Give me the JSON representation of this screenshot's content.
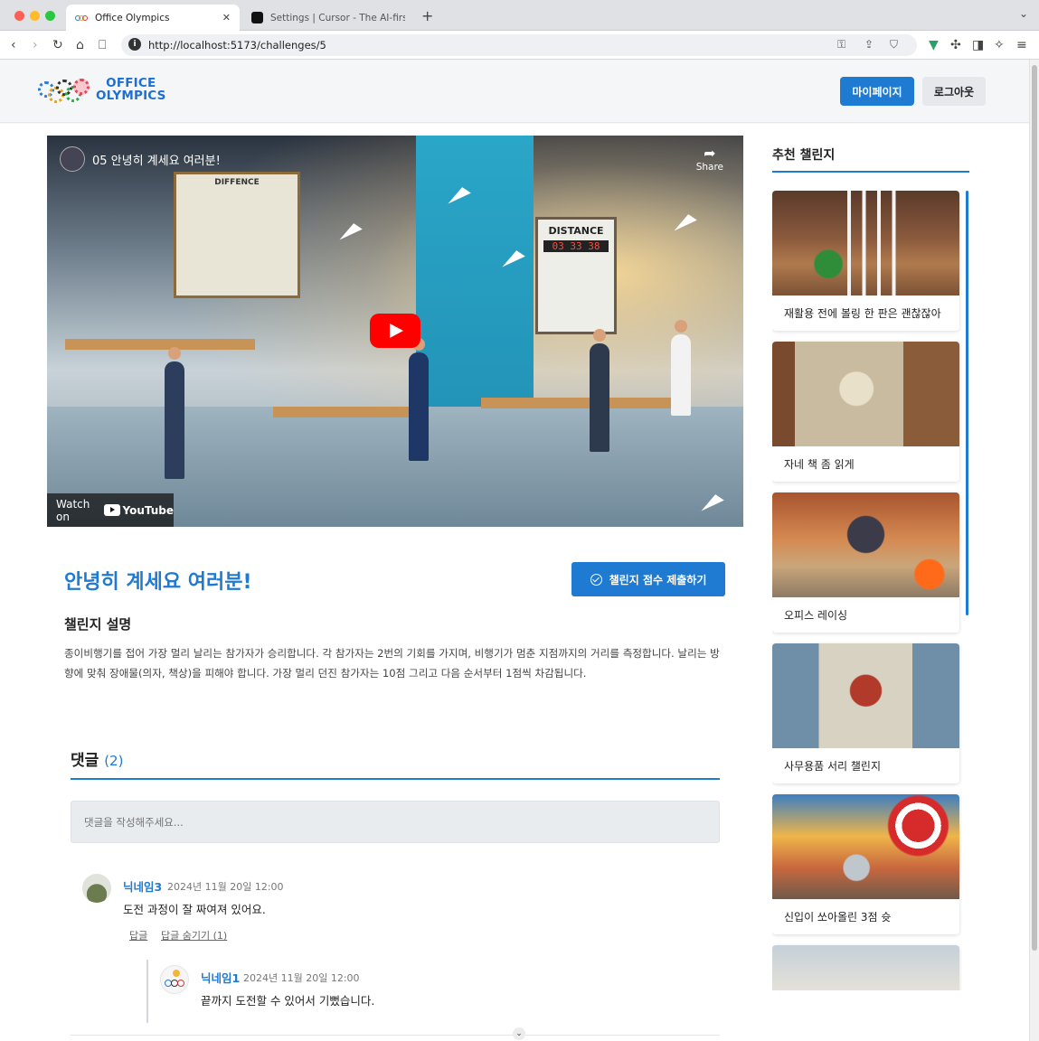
{
  "browser": {
    "tabs": [
      {
        "title": "Office Olympics",
        "active": true
      },
      {
        "title": "Settings | Cursor - The AI-first Cc",
        "active": false
      }
    ],
    "url": "http://localhost:5173/challenges/5",
    "icons": [
      "back-icon",
      "forward-icon",
      "reload-icon",
      "home-icon",
      "bookmark-icon",
      "key-icon",
      "share-icon",
      "brave-shield-icon",
      "vue-devtools-icon",
      "extensions-icon",
      "sidebar-icon",
      "leo-icon",
      "menu-icon"
    ]
  },
  "header": {
    "logo_line1": "OFFICE",
    "logo_line2": "OLYMPICS",
    "mypage_label": "마이페이지",
    "logout_label": "로그아웃",
    "accent_color": "#1f7ad1"
  },
  "video": {
    "title": "05 안녕히 계세요 여러분!",
    "share_label": "Share",
    "watch_on_label": "Watch on",
    "youtube_label": "YouTube",
    "scene_text": {
      "difference": "DIFFENCE",
      "distance": "DISTANCE",
      "counter": "03 33 38"
    }
  },
  "challenge": {
    "title": "안녕히 계세요 여러분!",
    "submit_label": "챌린지 점수 제출하기",
    "description_heading": "챌린지 설명",
    "description": "종이비행기를 접어 가장 멀리 날리는 참가자가 승리합니다. 각 참가자는 2번의 기회를 가지며, 비행기가 멈춘 지점까지의 거리를 측정합니다. 날리는 방향에 맞춰 장애물(의자, 책상)을 피해야 합니다. 가장 멀리 던진 참가자는 10점 그리고 다음 순서부터 1점씩 차감됩니다."
  },
  "comments": {
    "heading": "댓글",
    "count": "(2)",
    "input_placeholder": "댓글을 작성해주세요...",
    "items": [
      {
        "nickname": "닉네임3",
        "date": "2024년 11월 20일 12:00",
        "text": "도전 과정이 잘 짜여져 있어요.",
        "reply_label": "답글",
        "hide_replies_label": "답글 숨기기 (1)"
      },
      {
        "nickname": "닉네임1",
        "date": "2024년 11월 20일 12:00",
        "text": "끝까지 도전할 수 있어서 기뻤습니다."
      }
    ]
  },
  "sidebar": {
    "title": "추천 챌린지",
    "cards": [
      {
        "label": "재활용 전에 볼링 한 판은 괜찮잖아",
        "image": "bowling-image"
      },
      {
        "label": "자네 책 좀 읽게",
        "image": "books-image"
      },
      {
        "label": "오피스 레이싱",
        "image": "racing-image"
      },
      {
        "label": "사무용품 서리 챌린지",
        "image": "supplies-image"
      },
      {
        "label": "신입이 쏘아올린 3점 슛",
        "image": "basketball-image"
      },
      {
        "label": "",
        "image": "office-image"
      }
    ]
  }
}
